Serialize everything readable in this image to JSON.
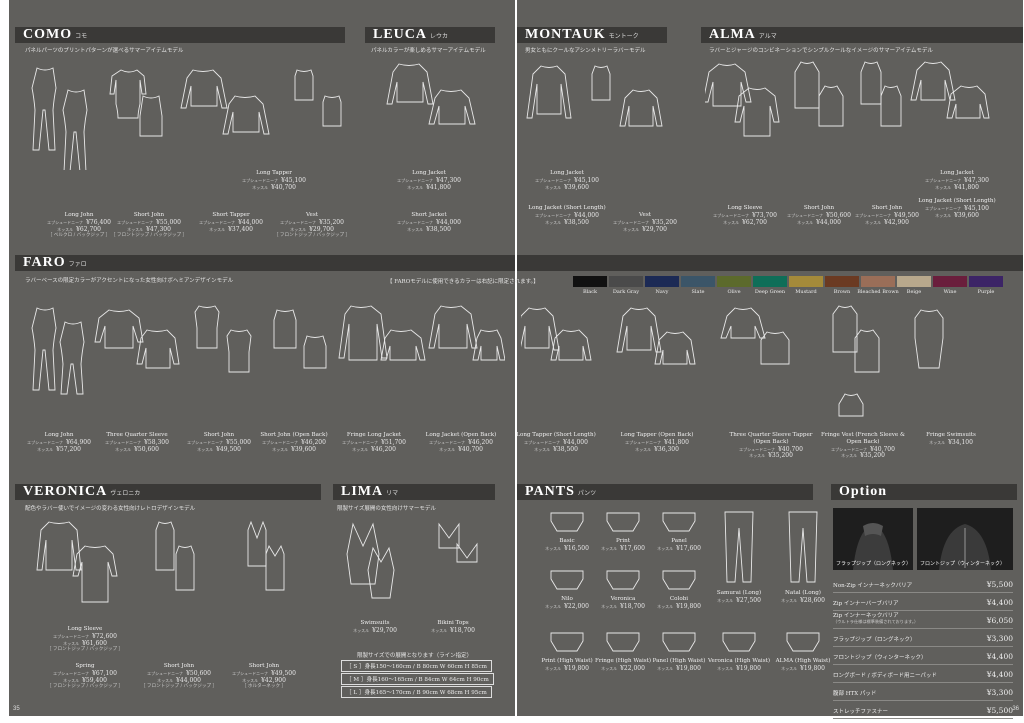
{
  "page_left": "35",
  "page_right": "36",
  "como": {
    "title": "COMO",
    "kana": "コモ",
    "sub": "パネルパーツのプリントパターンが選べるサマーアイテムモデル",
    "items": [
      {
        "name": "Long John",
        "lines": [
          [
            "エプシュードニーナ",
            "¥76,400"
          ],
          [
            "ネッスル",
            "¥62,700"
          ]
        ],
        "note": "［ ベルクロ / バックジップ ］"
      },
      {
        "name": "Short John",
        "lines": [
          [
            "エプシュードニーナ",
            "¥55,000"
          ],
          [
            "ネッスル",
            "¥47,300"
          ]
        ],
        "note": "［ フロントジップ / バックジップ ］"
      },
      {
        "name": "Long Tapper",
        "lines": [
          [
            "エプシュードニーナ",
            "¥45,100"
          ],
          [
            "ネッスル",
            "¥40,700"
          ]
        ]
      },
      {
        "name": "Short Tapper",
        "lines": [
          [
            "エプシュードニーナ",
            "¥44,000"
          ],
          [
            "ネッスル",
            "¥37,400"
          ]
        ]
      },
      {
        "name": "Vest",
        "lines": [
          [
            "エプシュードニーナ",
            "¥35,200"
          ],
          [
            "ネッスル",
            "¥29,700"
          ]
        ],
        "note": "［ フロントジップ / バックジップ ］"
      }
    ]
  },
  "leuca": {
    "title": "LEUCA",
    "kana": "レウカ",
    "sub": "パネルカラーが楽しめるサマーアイテムモデル",
    "items": [
      {
        "name": "Long Jacket",
        "lines": [
          [
            "エプシュードニーナ",
            "¥47,300"
          ],
          [
            "ネッスル",
            "¥41,800"
          ]
        ]
      },
      {
        "name": "Short Jacket",
        "lines": [
          [
            "エプシュードニーナ",
            "¥44,000"
          ],
          [
            "ネッスル",
            "¥38,500"
          ]
        ]
      }
    ]
  },
  "montauk": {
    "title": "MONTAUK",
    "kana": "モントーク",
    "sub": "男女ともにクールなアシンメトリーラバーモデル",
    "items": [
      {
        "name": "Long Jacket",
        "lines": [
          [
            "エプシュードニーナ",
            "¥45,100"
          ],
          [
            "ネッスル",
            "¥39,600"
          ]
        ]
      },
      {
        "name": "Long Jacket (Short Length)",
        "lines": [
          [
            "エプシュードニーナ",
            "¥44,000"
          ],
          [
            "ネッスル",
            "¥38,500"
          ]
        ]
      },
      {
        "name": "Vest",
        "lines": [
          [
            "エプシュードニーナ",
            "¥35,200"
          ],
          [
            "ネッスル",
            "¥29,700"
          ]
        ]
      }
    ]
  },
  "alma": {
    "title": "ALMA",
    "kana": "アルマ",
    "sub": "ラバーとジャージのコンビネーションでシンプルクールなイメージのサマーアイテムモデル",
    "items": [
      {
        "name": "Long Sleeve",
        "lines": [
          [
            "エプシュードニーナ",
            "¥73,700"
          ],
          [
            "ネッスル",
            "¥62,700"
          ]
        ]
      },
      {
        "name": "Short John",
        "lines": [
          [
            "エプシュードニーナ",
            "¥50,600"
          ],
          [
            "ネッスル",
            "¥44,000"
          ]
        ]
      },
      {
        "name": "Short John",
        "lines": [
          [
            "エプシュードニーナ",
            "¥49,500"
          ],
          [
            "ネッスル",
            "¥42,900"
          ]
        ]
      },
      {
        "name": "Long Jacket",
        "lines": [
          [
            "エプシュードニーナ",
            "¥47,300"
          ],
          [
            "ネッスル",
            "¥41,800"
          ]
        ]
      },
      {
        "name": "Long Jacket (Short Length)",
        "lines": [
          [
            "エプシュードニーナ",
            "¥45,100"
          ],
          [
            "ネッスル",
            "¥39,600"
          ]
        ]
      }
    ]
  },
  "faro": {
    "title": "FARO",
    "kana": "ファロ",
    "sub": "ラバーベースの限定カラーがアクセントになった女性向けボヘミアンデザインモデル",
    "color_note": "【 FAROモデルに使用できるカラーは右記に限定されます。】",
    "colors": [
      {
        "name": "Black",
        "hex": "#111111"
      },
      {
        "name": "Dark Gray",
        "hex": "#4a4a4a"
      },
      {
        "name": "Navy",
        "hex": "#1c2a55"
      },
      {
        "name": "Slate",
        "hex": "#3b5568"
      },
      {
        "name": "Olive",
        "hex": "#5c6a2c"
      },
      {
        "name": "Deep Green",
        "hex": "#0f6e58"
      },
      {
        "name": "Mustard",
        "hex": "#a48a3a"
      },
      {
        "name": "Brown",
        "hex": "#6b3a22"
      },
      {
        "name": "Bleached Brown",
        "hex": "#9a6e58"
      },
      {
        "name": "Beige",
        "hex": "#b8a88c"
      },
      {
        "name": "Wine",
        "hex": "#6a1e3c"
      },
      {
        "name": "Purple",
        "hex": "#3c2466"
      }
    ],
    "items": [
      {
        "name": "Long John",
        "lines": [
          [
            "エプシュードニーナ",
            "¥64,900"
          ],
          [
            "ネッスル",
            "¥57,200"
          ]
        ]
      },
      {
        "name": "Three Quarter Sleeve",
        "lines": [
          [
            "エプシュードニーナ",
            "¥58,300"
          ],
          [
            "ネッスル",
            "¥50,600"
          ]
        ]
      },
      {
        "name": "Short John",
        "lines": [
          [
            "エプシュードニーナ",
            "¥55,000"
          ],
          [
            "ネッスル",
            "¥49,500"
          ]
        ]
      },
      {
        "name": "Short John (Open Back)",
        "lines": [
          [
            "エプシュードニーナ",
            "¥46,200"
          ],
          [
            "ネッスル",
            "¥39,600"
          ]
        ]
      },
      {
        "name": "Fringe Long Jacket",
        "lines": [
          [
            "エプシュードニーナ",
            "¥51,700"
          ],
          [
            "ネッスル",
            "¥46,200"
          ]
        ]
      },
      {
        "name": "Long Jacket (Open Back)",
        "lines": [
          [
            "エプシュードニーナ",
            "¥46,200"
          ],
          [
            "ネッスル",
            "¥40,700"
          ]
        ]
      },
      {
        "name": "Long Tapper (Short Length)",
        "lines": [
          [
            "エプシュードニーナ",
            "¥44,000"
          ],
          [
            "ネッスル",
            "¥38,500"
          ]
        ]
      },
      {
        "name": "Long Tapper (Open Back)",
        "lines": [
          [
            "エプシュードニーナ",
            "¥41,800"
          ],
          [
            "ネッスル",
            "¥36,300"
          ]
        ]
      },
      {
        "name": "Three Quarter Sleeve Tapper (Open Back)",
        "lines": [
          [
            "エプシュードニーナ",
            "¥40,700"
          ],
          [
            "ネッスル",
            "¥35,200"
          ]
        ]
      },
      {
        "name": "Fringe Vest (French Sleeve & Open Back)",
        "lines": [
          [
            "エプシュードニーナ",
            "¥40,700"
          ],
          [
            "ネッスル",
            "¥35,200"
          ]
        ]
      },
      {
        "name": "Fringe Swimsuits",
        "lines": [
          [
            "ネッスル",
            "¥34,100"
          ]
        ]
      }
    ]
  },
  "veronica": {
    "title": "VERONICA",
    "kana": "ヴェロニカ",
    "sub": "配色やラバー使いでイメージの変わる女性向けレトロデザインモデル",
    "items": [
      {
        "name": "Long Sleeve",
        "lines": [
          [
            "エプシュードニーナ",
            "¥72,600"
          ],
          [
            "ネッスル",
            "¥61,600"
          ]
        ],
        "note": "［ フロントジップ / バックジップ ］"
      },
      {
        "name": "Spring",
        "lines": [
          [
            "エプシュードニーナ",
            "¥67,100"
          ],
          [
            "ネッスル",
            "¥59,400"
          ]
        ],
        "note": "［ フロントジップ / バックジップ ］"
      },
      {
        "name": "Short John",
        "lines": [
          [
            "エプシュードニーナ",
            "¥50,600"
          ],
          [
            "ネッスル",
            "¥44,000"
          ]
        ],
        "note": "［ フロントジップ / バックジップ ］"
      },
      {
        "name": "Short John",
        "lines": [
          [
            "エプシュードニーナ",
            "¥49,500"
          ],
          [
            "ネッスル",
            "¥42,900"
          ]
        ],
        "note": "［ ホルターネック ］"
      }
    ]
  },
  "lima": {
    "title": "LIMA",
    "kana": "リマ",
    "sub": "限製サイズ展開の女性向けサマーモデル",
    "items": [
      {
        "name": "Swimsuits",
        "lines": [
          [
            "ネッスル",
            "¥29,700"
          ]
        ]
      },
      {
        "name": "Bikini Tops",
        "lines": [
          [
            "ネッスル",
            "¥18,700"
          ]
        ]
      }
    ],
    "size_note": "限製サイズでの展開となります（ライン指定）",
    "sizes": [
      "［ S ］身長150〜160cm / B 80cm W 60cm H 85cm",
      "［ M ］身長160〜165cm / B 84cm W 64cm H 90cm",
      "［ L ］身長165〜170cm / B 90cm W 68cm H 95cm"
    ]
  },
  "pants": {
    "title": "PANTS",
    "kana": "パンツ",
    "items": [
      {
        "name": "Basic",
        "lines": [
          [
            "ネッスル",
            "¥16,500"
          ]
        ]
      },
      {
        "name": "Print",
        "lines": [
          [
            "ネッスル",
            "¥17,600"
          ]
        ]
      },
      {
        "name": "Panel",
        "lines": [
          [
            "ネッスル",
            "¥17,600"
          ]
        ]
      },
      {
        "name": "Nilo",
        "lines": [
          [
            "ネッスル",
            "¥22,000"
          ]
        ]
      },
      {
        "name": "Veronica",
        "lines": [
          [
            "ネッスル",
            "¥18,700"
          ]
        ]
      },
      {
        "name": "Colobi",
        "lines": [
          [
            "ネッスル",
            "¥19,800"
          ]
        ]
      },
      {
        "name": "Samurai (Long)",
        "lines": [
          [
            "ネッスル",
            "¥27,500"
          ]
        ]
      },
      {
        "name": "Natal (Long)",
        "lines": [
          [
            "ネッスル",
            "¥28,600"
          ]
        ]
      },
      {
        "name": "Print (High Waist)",
        "lines": [
          [
            "ネッスル",
            "¥19,800"
          ]
        ]
      },
      {
        "name": "Fringe (High Waist)",
        "lines": [
          [
            "ネッスル",
            "¥22,000"
          ]
        ]
      },
      {
        "name": "Panel (High Waist)",
        "lines": [
          [
            "ネッスル",
            "¥19,800"
          ]
        ]
      },
      {
        "name": "Veronica (High Waist)",
        "lines": [
          [
            "ネッスル",
            "¥19,800"
          ]
        ]
      },
      {
        "name": "ALMA (High Waist)",
        "lines": [
          [
            "ネッスル",
            "¥19,800"
          ]
        ]
      }
    ]
  },
  "option": {
    "title": "Option",
    "photos": [
      "フラップジップ（ロングネック）",
      "フロントジップ（ウィンターネック）"
    ],
    "rows": [
      {
        "name": "Non-Zip インナーネックバリア",
        "value": "¥5,500"
      },
      {
        "name": "Zip インナーバーブバリア",
        "value": "¥4,400"
      },
      {
        "name": "Zip インナーネックバリア",
        "note": "（ウルトラ仕様は標準装備されております。）",
        "value": "¥6,050"
      },
      {
        "name": "フラップジップ（ロングネック）",
        "value": "¥3,300"
      },
      {
        "name": "フロントジップ（ウィンターネック）",
        "value": "¥4,400"
      },
      {
        "name": "ロングボード / ボディボード用ニーパッド",
        "value": "¥4,400"
      },
      {
        "name": "腹部 HTX パッド",
        "value": "¥3,300"
      },
      {
        "name": "ストレッチファスナー",
        "value": "¥5,500"
      }
    ]
  }
}
